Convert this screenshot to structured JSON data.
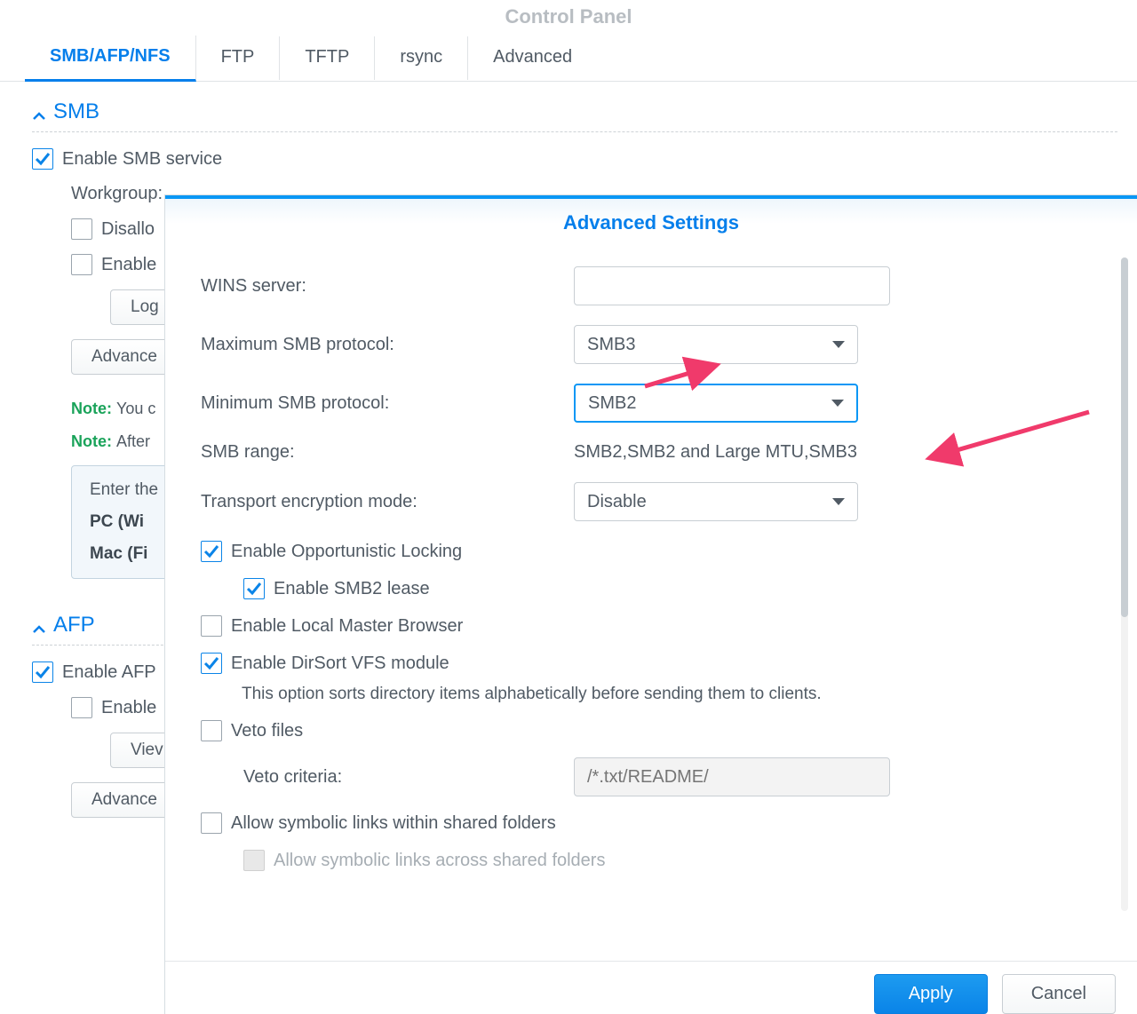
{
  "window": {
    "title": "Control Panel"
  },
  "tabs": [
    "SMB/AFP/NFS",
    "FTP",
    "TFTP",
    "rsync",
    "Advanced"
  ],
  "sections": {
    "smb": {
      "title": "SMB",
      "enable_label": "Enable SMB service",
      "workgroup_label": "Workgroup:",
      "disallow_label": "Disallo",
      "enable_prev_label": "Enable",
      "log_btn": "Log",
      "adv_btn": "Advance",
      "note1_prefix": "Note:",
      "note1_text": "You c",
      "note2_prefix": "Note:",
      "note2_text": "After",
      "panel_intro": "Enter the",
      "panel_pc": "PC (Wi",
      "panel_mac": "Mac (Fi"
    },
    "afp": {
      "title": "AFP",
      "enable_label": "Enable AFP",
      "enable_sub_label": "Enable",
      "view_btn": "Viev",
      "adv_btn": "Advance"
    }
  },
  "modal": {
    "title": "Advanced Settings",
    "wins_label": "WINS server:",
    "wins_value": "",
    "max_proto_label": "Maximum SMB protocol:",
    "max_proto_value": "SMB3",
    "min_proto_label": "Minimum SMB protocol:",
    "min_proto_value": "SMB2",
    "range_label": "SMB range:",
    "range_value": "SMB2,SMB2 and Large MTU,SMB3",
    "transport_label": "Transport encryption mode:",
    "transport_value": "Disable",
    "oplock_label": "Enable Opportunistic Locking",
    "smb2lease_label": "Enable SMB2 lease",
    "localmaster_label": "Enable Local Master Browser",
    "dirsort_label": "Enable DirSort VFS module",
    "dirsort_hint": "This option sorts directory items alphabetically before sending them to clients.",
    "veto_label": "Veto files",
    "veto_criteria_label": "Veto criteria:",
    "veto_placeholder": "/*.txt/README/",
    "symlink1_label": "Allow symbolic links within shared folders",
    "symlink2_label": "Allow symbolic links across shared folders",
    "apply": "Apply",
    "cancel": "Cancel"
  }
}
